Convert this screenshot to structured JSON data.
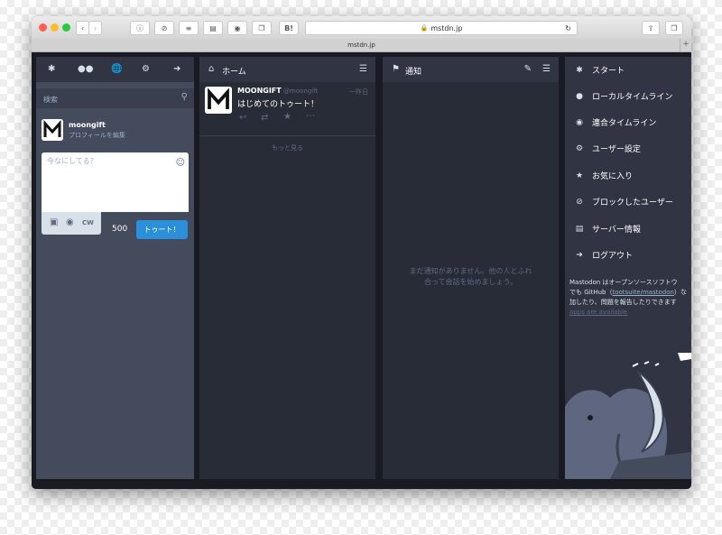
{
  "window": {
    "address": "mstdn.jp",
    "tab_title": "mstdn.jp",
    "colors": {
      "close": "#ff5f57",
      "minimize": "#febc2e",
      "zoom": "#28c840",
      "accent": "#2b90d9"
    },
    "toolbar_buttons": [
      "back-icon",
      "forward-icon",
      "info-icon",
      "block-icon",
      "layers-icon",
      "layout-icon",
      "shield-icon",
      "copy-icon",
      "hatena-bookmark-icon",
      "share-icon",
      "tabs-icon"
    ],
    "hatena_label": "B!"
  },
  "drawer": {
    "nav_icons": [
      "asterisk-icon",
      "users-icon",
      "globe-icon",
      "gear-icon",
      "sign-out-icon"
    ],
    "search_placeholder": "検索",
    "user": {
      "name": "moongift",
      "edit_profile": "プロフィールを編集"
    },
    "compose": {
      "placeholder": "今なにしてる？",
      "cw_label": "CW",
      "char_count": "500",
      "toot_label": "トゥート！"
    }
  },
  "home": {
    "title": "ホーム",
    "status": {
      "display_name": "MOONGIFT",
      "handle": "@moongift",
      "time": "一昨日",
      "content": "はじめてのトゥート！"
    },
    "load_more": "もっと見る"
  },
  "notifications": {
    "title": "通知",
    "empty": [
      "まだ通知がありません。他の人とふれ",
      "合って会話を始めましょう。"
    ]
  },
  "menu": {
    "items": [
      {
        "icon": "asterisk-icon",
        "label": "スタート"
      },
      {
        "icon": "users-icon",
        "label": "ローカルタイムライン"
      },
      {
        "icon": "globe-icon",
        "label": "連合タイムライン"
      },
      {
        "icon": "gear-icon",
        "label": "ユーザー設定"
      },
      {
        "icon": "star-icon",
        "label": "お気に入り"
      },
      {
        "icon": "block-icon",
        "label": "ブロックしたユーザー"
      },
      {
        "icon": "book-icon",
        "label": "サーバー情報"
      },
      {
        "icon": "sign-out-icon",
        "label": "ログアウト"
      }
    ],
    "about_lines": [
      "Mastodon はオープンソースソフトウ",
      "でも GitHub（",
      "tootsuite/mastodon",
      "）な",
      "加したり、問題を報告したりできます",
      "apps are available"
    ]
  }
}
